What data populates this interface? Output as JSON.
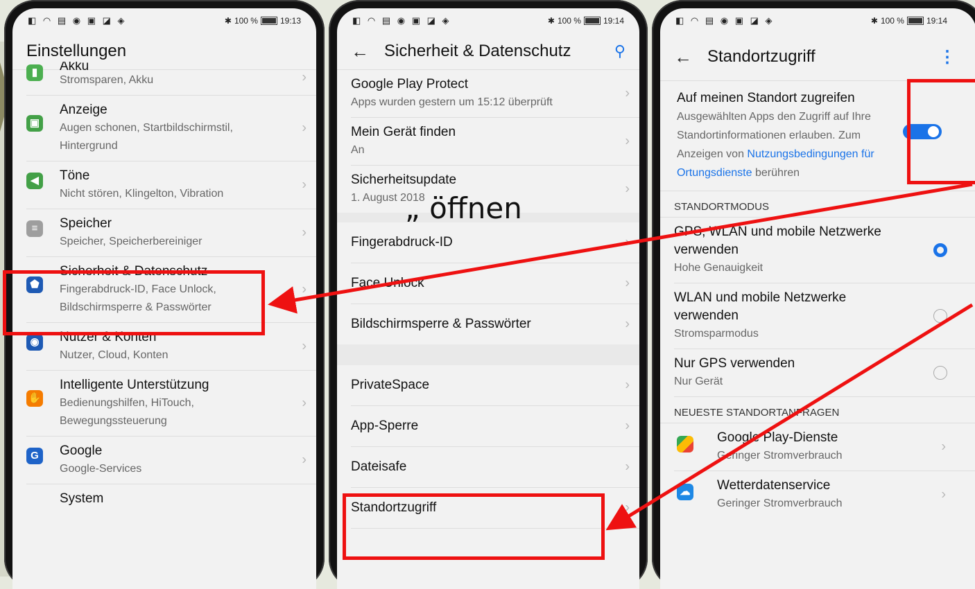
{
  "status": {
    "battery_pct": "100 %",
    "time_left": "19:13",
    "time_mid": "19:14",
    "time_right": "19:14"
  },
  "left": {
    "title": "Einstellungen",
    "items": [
      {
        "title": "Akku",
        "sub": "Stromsparen, Akku",
        "color": "#4caf50",
        "icon": "battery-icon"
      },
      {
        "title": "Anzeige",
        "sub": "Augen schonen, Startbildschirmstil, Hintergrund",
        "color": "#43a047",
        "icon": "display-icon"
      },
      {
        "title": "Töne",
        "sub": "Nicht stören, Klingelton, Vibration",
        "color": "#43a047",
        "icon": "sound-icon"
      },
      {
        "title": "Speicher",
        "sub": "Speicher, Speicherbereiniger",
        "color": "#9e9e9e",
        "icon": "storage-icon"
      },
      {
        "title": "Sicherheit & Datenschutz",
        "sub": "Fingerabdruck-ID, Face Unlock, Bildschirmsperre & Passwörter",
        "color": "#1e5ab4",
        "icon": "shield-icon"
      },
      {
        "title": "Nutzer & Konten",
        "sub": "Nutzer, Cloud, Konten",
        "color": "#1e5ab4",
        "icon": "user-icon"
      },
      {
        "title": "Intelligente Unterstützung",
        "sub": "Bedienungshilfen, HiTouch, Bewegungssteuerung",
        "color": "#f57c00",
        "icon": "hand-icon"
      },
      {
        "title": "Google",
        "sub": "Google-Services",
        "color": "#1e63c8",
        "icon": "google-icon"
      },
      {
        "title": "System",
        "sub": "",
        "color": "",
        "icon": ""
      }
    ]
  },
  "mid": {
    "title": "Sicherheit & Datenschutz",
    "group1": [
      {
        "title": "Google Play Protect",
        "sub": "Apps wurden gestern um 15:12 überprüft"
      },
      {
        "title": "Mein Gerät finden",
        "sub": "An"
      },
      {
        "title": "Sicherheitsupdate",
        "sub": "1. August 2018"
      }
    ],
    "group2": [
      {
        "title": "Fingerabdruck-ID"
      },
      {
        "title": "Face Unlock"
      },
      {
        "title": "Bildschirmsperre & Passwörter"
      }
    ],
    "group3": [
      {
        "title": "PrivateSpace"
      },
      {
        "title": "App-Sperre"
      },
      {
        "title": "Dateisafe"
      },
      {
        "title": "Standortzugriff"
      }
    ]
  },
  "right": {
    "title": "Standortzugriff",
    "access_title": "Auf meinen Standort zugreifen",
    "access_desc_1": "Ausgewählten Apps den Zugriff auf Ihre Standortinformationen erlauben. Zum Anzeigen von",
    "access_link": "Nutzungsbedingungen für Ortungsdienste",
    "access_desc_2": "berühren",
    "mode_header": "STANDORTMODUS",
    "modes": [
      {
        "title": "GPS, WLAN und mobile Netzwerke verwenden",
        "sub": "Hohe Genauigkeit",
        "selected": true
      },
      {
        "title": "WLAN und mobile Netzwerke verwenden",
        "sub": "Stromsparmodus",
        "selected": false
      },
      {
        "title": "Nur GPS verwenden",
        "sub": "Nur Gerät",
        "selected": false
      }
    ],
    "requests_header": "NEUESTE STANDORTANFRAGEN",
    "requests": [
      {
        "title": "Google Play-Dienste",
        "sub": "Geringer Stromverbrauch",
        "icon": "play-services-icon"
      },
      {
        "title": "Wetterdatenservice",
        "sub": "Geringer Stromverbrauch",
        "icon": "weather-icon"
      }
    ]
  },
  "overlay": {
    "caption": "„ öffnen"
  },
  "colors": {
    "accent": "#1a73e8",
    "highlight": "#ee1111"
  }
}
